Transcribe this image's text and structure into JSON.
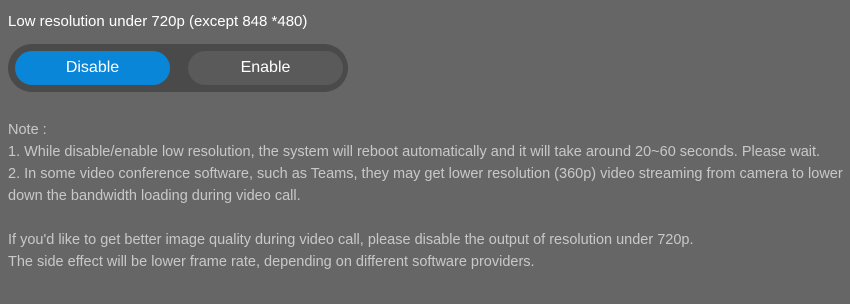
{
  "setting": {
    "title": "Low resolution under 720p (except 848 *480)",
    "options": {
      "disable": "Disable",
      "enable": "Enable"
    },
    "selected": "Disable"
  },
  "note": {
    "heading": "Note :",
    "item1": "1. While disable/enable low resolution, the system will reboot automatically and it will take around 20~60 seconds. Please wait.",
    "item2": "2. In some video conference software, such as Teams, they may get lower resolution (360p) video streaming from camera to lower down the bandwidth loading during video call.",
    "tip_line1": "If you'd like to get better image quality during video call, please disable the output of resolution under 720p.",
    "tip_line2": "The side effect will be lower frame rate, depending on different software providers."
  },
  "colors": {
    "background": "#666666",
    "toggle_track": "#4a4a4a",
    "active_button": "#0a86d8",
    "note_text": "#c8c8c8"
  }
}
